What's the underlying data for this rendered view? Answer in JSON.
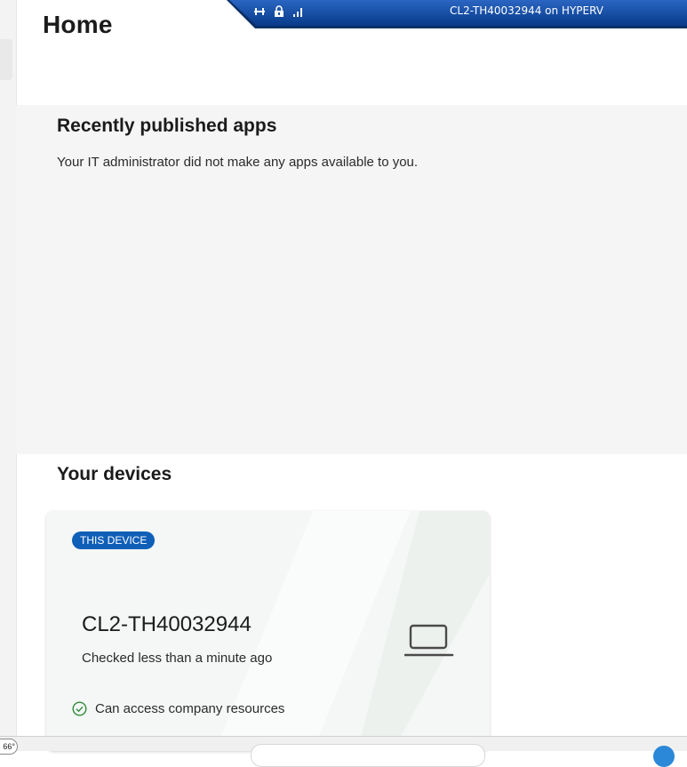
{
  "page": {
    "title": "Home"
  },
  "remote_session": {
    "title": "CL2-TH40032944 on HYPERV",
    "icons": [
      "pin-icon",
      "lock-icon",
      "signal-bars-icon"
    ],
    "bar_color": "#0a3d8f"
  },
  "recent_apps": {
    "heading": "Recently published apps",
    "empty_message": "Your IT administrator did not make any apps available to you."
  },
  "devices": {
    "heading": "Your devices",
    "cards": [
      {
        "badge": "THIS DEVICE",
        "name": "CL2-TH40032944",
        "last_checked": "Checked less than a minute ago",
        "status": "Can access company resources",
        "icon": "laptop-icon",
        "status_icon": "check-circle-icon",
        "status_color": "#2e8b3a"
      }
    ]
  },
  "taskbar": {
    "badge": "66°",
    "items": [
      "search-box",
      "app-icon"
    ]
  },
  "colors": {
    "accent": "#0f5fb8",
    "section_background": "#f5f5f5"
  }
}
